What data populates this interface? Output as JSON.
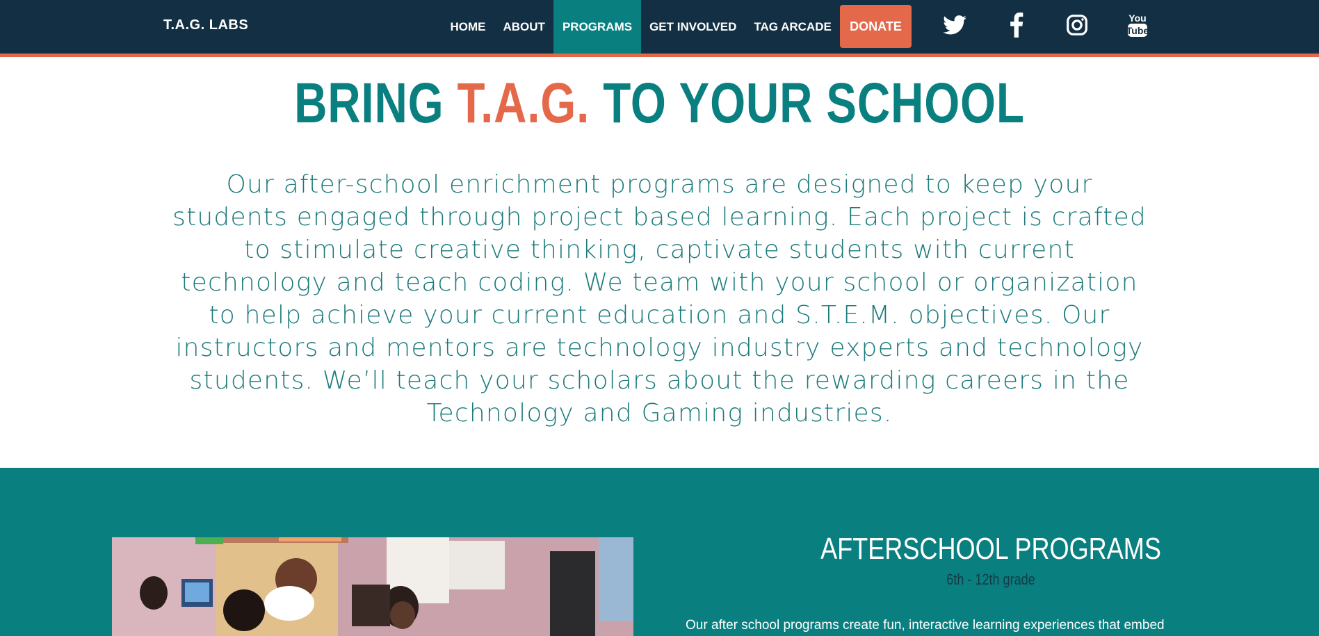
{
  "nav": {
    "brand": "T.A.G. LABS",
    "links": [
      {
        "label": "HOME"
      },
      {
        "label": "ABOUT"
      },
      {
        "label": "PROGRAMS",
        "active": true
      },
      {
        "label": "GET INVOLVED"
      },
      {
        "label": "TAG ARCADE"
      }
    ],
    "donate": "DONATE",
    "social": [
      "twitter-icon",
      "facebook-icon",
      "instagram-icon",
      "youtube-icon"
    ]
  },
  "hero": {
    "title_pre": "BRING ",
    "title_accent": "T.A.G.",
    "title_post": " TO YOUR SCHOOL",
    "paragraph": "Our after-school enrichment programs are designed to keep your students engaged through project based learning. Each project is crafted to stimulate creative thinking, captivate students with current technology and teach coding. We team with your school or organization to help achieve your current education and S.T.E.M. objectives. Our instructors and mentors are technology industry experts and technology students. We’ll teach your scholars about the rewarding careers in the Technology and Gaming industries."
  },
  "programs": {
    "title": "AFTERSCHOOL PROGRAMS",
    "subtitle": "6th - 12th grade",
    "text": "Our after school programs create fun, interactive learning experiences that embed"
  },
  "colors": {
    "navy": "#132f44",
    "teal": "#0a7f80",
    "orange": "#e4694b"
  }
}
